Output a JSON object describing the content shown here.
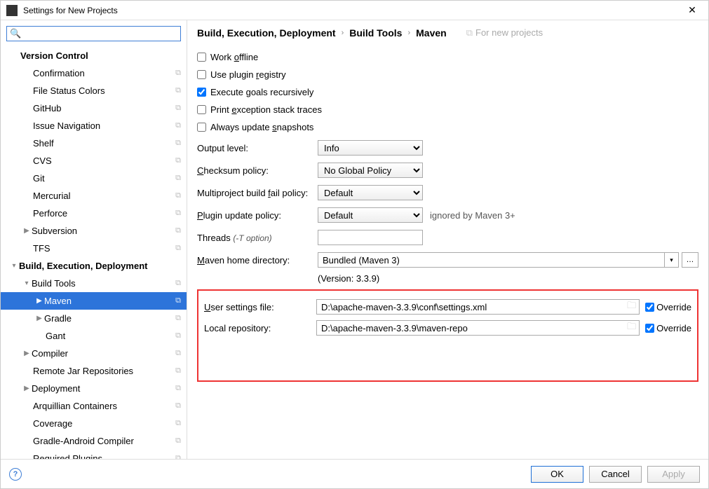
{
  "window": {
    "title": "Settings for New Projects"
  },
  "search": {
    "placeholder": ""
  },
  "tree": {
    "versionControl": {
      "label": "Version Control"
    },
    "items": [
      {
        "label": "Confirmation"
      },
      {
        "label": "File Status Colors"
      },
      {
        "label": "GitHub"
      },
      {
        "label": "Issue Navigation"
      },
      {
        "label": "Shelf"
      },
      {
        "label": "CVS"
      },
      {
        "label": "Git"
      },
      {
        "label": "Mercurial"
      },
      {
        "label": "Perforce"
      }
    ],
    "subversion": {
      "label": "Subversion"
    },
    "tfs": {
      "label": "TFS"
    },
    "bed": {
      "label": "Build, Execution, Deployment"
    },
    "buildTools": {
      "label": "Build Tools"
    },
    "maven": {
      "label": "Maven"
    },
    "gradle": {
      "label": "Gradle"
    },
    "gant": {
      "label": "Gant"
    },
    "compiler": {
      "label": "Compiler"
    },
    "remoteJar": {
      "label": "Remote Jar Repositories"
    },
    "deployment": {
      "label": "Deployment"
    },
    "arquillian": {
      "label": "Arquillian Containers"
    },
    "coverage": {
      "label": "Coverage"
    },
    "gradleAndroid": {
      "label": "Gradle-Android Compiler"
    },
    "requiredPlugins": {
      "label": "Required Plugins"
    }
  },
  "breadcrumb": {
    "a": "Build, Execution, Deployment",
    "b": "Build Tools",
    "c": "Maven",
    "hint": "For new projects"
  },
  "checks": {
    "workOffline": "Work offline",
    "usePluginRegistry": "Use plugin registry",
    "executeGoals": "Execute goals recursively",
    "printException": "Print exception stack traces",
    "alwaysUpdate": "Always update snapshots"
  },
  "fields": {
    "outputLevel": {
      "label": "Output level:",
      "value": "Info"
    },
    "checksumPolicy": {
      "label": "Checksum policy:",
      "value": "No Global Policy"
    },
    "multiproject": {
      "label": "Multiproject build fail policy:",
      "value": "Default"
    },
    "pluginUpdate": {
      "label": "Plugin update policy:",
      "value": "Default",
      "note": "ignored by Maven 3+"
    },
    "threads": {
      "label": "Threads ",
      "hint": "(-T option)",
      "value": ""
    },
    "mavenHome": {
      "label": "Maven home directory:",
      "value": "Bundled (Maven 3)"
    },
    "version": "(Version: 3.3.9)",
    "userSettings": {
      "label": "User settings file:",
      "value": "D:\\apache-maven-3.3.9\\conf\\settings.xml",
      "override": "Override"
    },
    "localRepo": {
      "label": "Local repository:",
      "value": "D:\\apache-maven-3.3.9\\maven-repo",
      "override": "Override"
    }
  },
  "buttons": {
    "ok": "OK",
    "cancel": "Cancel",
    "apply": "Apply"
  }
}
